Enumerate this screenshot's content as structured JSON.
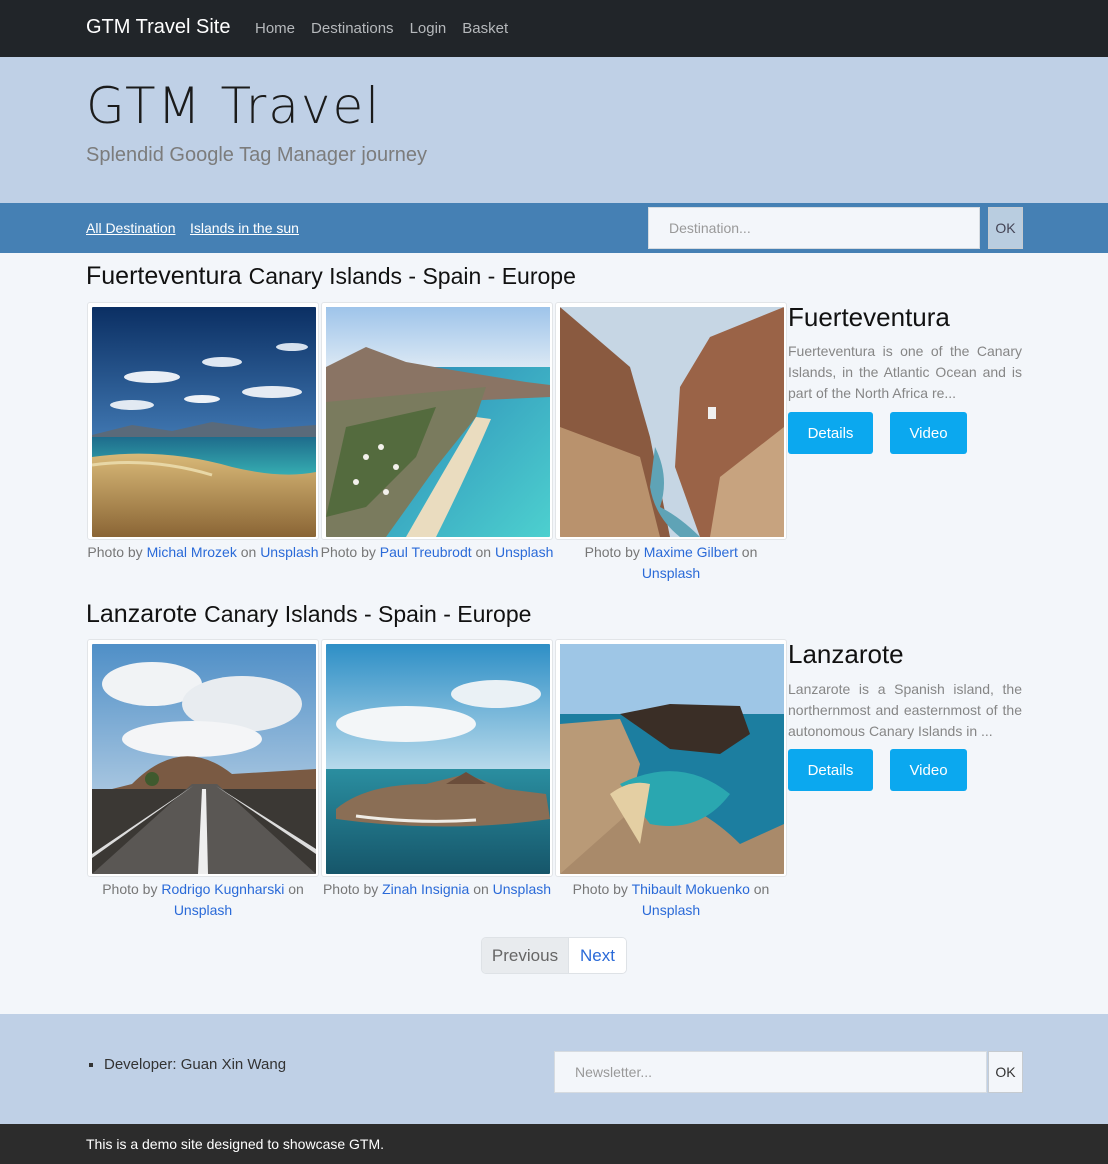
{
  "navbar": {
    "brand": "GTM Travel Site",
    "links": [
      "Home",
      "Destinations",
      "Login",
      "Basket"
    ]
  },
  "jumbotron": {
    "title": "GTM Travel",
    "subtitle": "Splendid Google Tag Manager journey"
  },
  "filter": {
    "links": [
      "All Destination",
      "Islands in the sun"
    ],
    "search_placeholder": "Destination...",
    "ok_label": "OK"
  },
  "destinations": [
    {
      "name": "Fuerteventura",
      "location": "Canary Islands - Spain - Europe",
      "info_title": "Fuerteventura",
      "description": "Fuerteventura is one of the Canary Islands, in the Atlantic Ocean and is part of the North Africa re...",
      "details_label": "Details",
      "video_label": "Video",
      "photos": [
        {
          "prefix": "Photo by",
          "author": "Michal Mrozek",
          "on": "on",
          "source": "Unsplash"
        },
        {
          "prefix": "Photo by",
          "author": "Paul Treubrodt",
          "on": "on",
          "source": "Unsplash"
        },
        {
          "prefix": "Photo by",
          "author": "Maxime Gilbert",
          "on": "on",
          "source": "Unsplash"
        }
      ]
    },
    {
      "name": "Lanzarote",
      "location": "Canary Islands - Spain - Europe",
      "info_title": "Lanzarote",
      "description": "Lanzarote is a Spanish island, the northernmost and easternmost of the autonomous Canary Islands in ...",
      "details_label": "Details",
      "video_label": "Video",
      "photos": [
        {
          "prefix": "Photo by",
          "author": "Rodrigo Kugnharski",
          "on": "on",
          "source": "Unsplash"
        },
        {
          "prefix": "Photo by",
          "author": "Zinah Insignia",
          "on": "on",
          "source": "Unsplash"
        },
        {
          "prefix": "Photo by",
          "author": "Thibault Mokuenko",
          "on": "on",
          "source": "Unsplash"
        }
      ]
    }
  ],
  "pagination": {
    "previous": "Previous",
    "next": "Next"
  },
  "footer": {
    "developer": "Developer: Guan Xin Wang",
    "newsletter_placeholder": "Newsletter...",
    "ok_label": "OK",
    "note": "This is a demo site designed to showcase GTM."
  }
}
